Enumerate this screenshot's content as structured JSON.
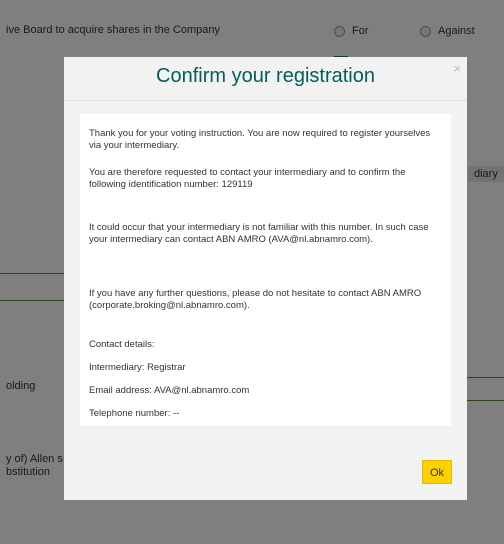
{
  "background": {
    "resolution_text": "ive Board to acquire shares in the Company",
    "vote_for": "For",
    "vote_against": "Against",
    "intermediary_tab": "diary",
    "holding_text": "olding",
    "allen_line1": "y of) Allen s",
    "allen_line2": "bstitution"
  },
  "modal": {
    "title": "Confirm your registration",
    "close_glyph": "×",
    "paragraphs": {
      "p1": "Thank you for your voting instruction. You are now required to register yourselves via your intermediary.",
      "p2": "You are therefore requested to contact your intermediary and to confirm the following identification number: 129119",
      "p3": "It could occur that your intermediary is not familiar with this number. In such case your intermediary can contact ABN AMRO (AVA@nl.abnamro.com).",
      "p4": "If you have any further questions, please do not hesitate to contact ABN AMRO (corporate.broking@nl.abnamro.com).",
      "contact_heading": "Contact details:",
      "intermediary": "Intermediary: Registrar",
      "email": "Email address: AVA@nl.abnamro.com",
      "telephone": "Telephone number: --"
    },
    "ok_label": "Ok"
  },
  "colors": {
    "title": "#005e5d",
    "ok_button": "#ffd100",
    "overlay": "rgba(0,0,0,0.5)"
  }
}
